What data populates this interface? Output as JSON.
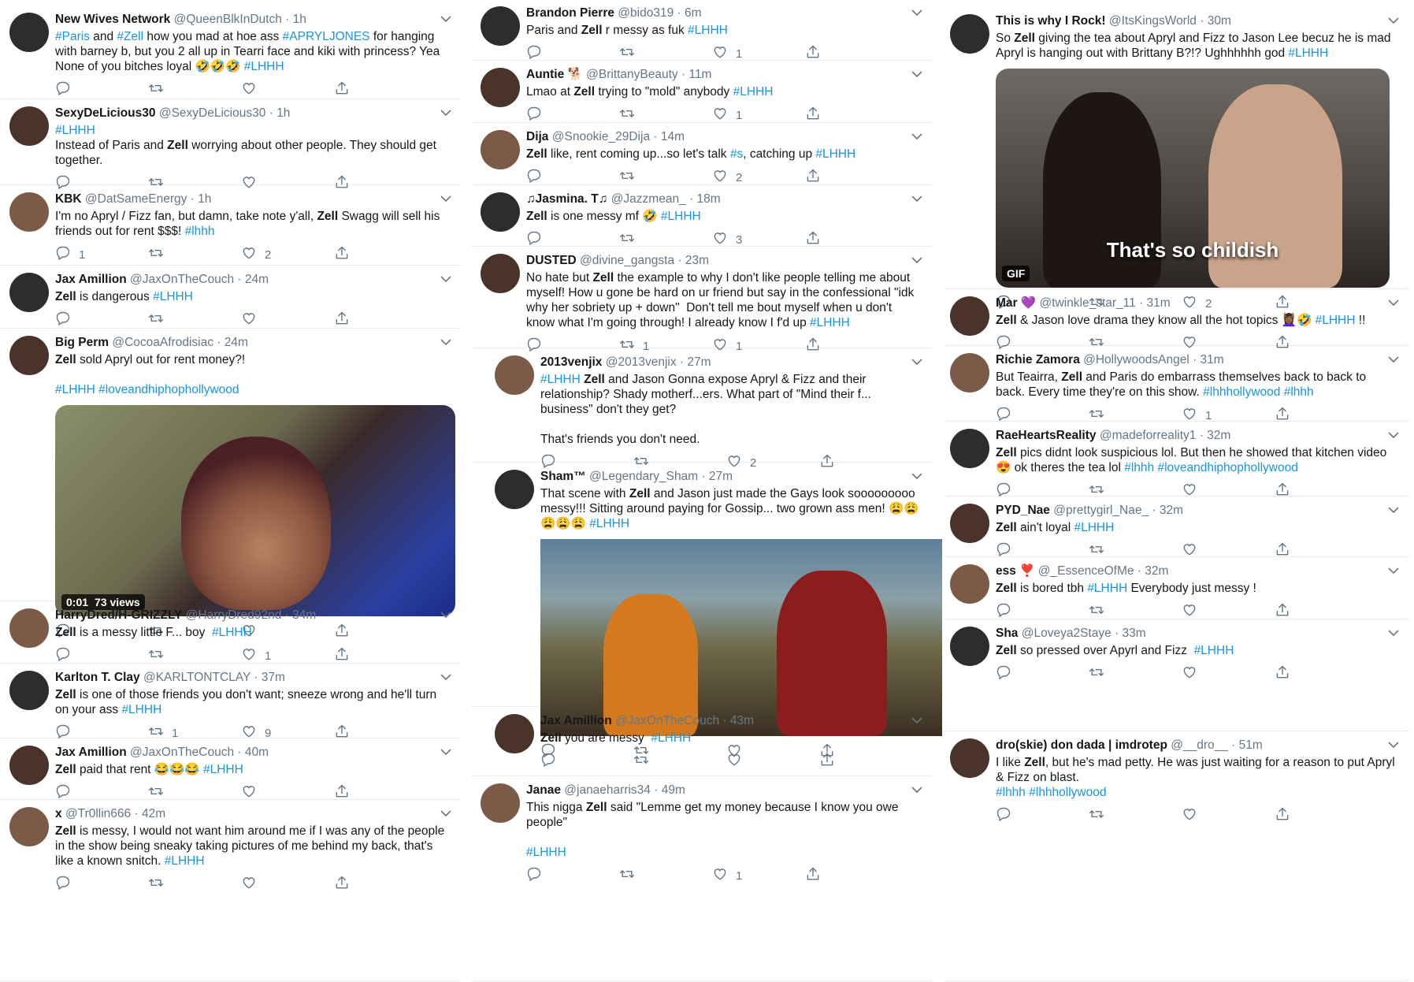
{
  "col1": [
    {
      "name": "New Wives Network",
      "handle": "@QueenBlkInDutch",
      "time": "· 1h",
      "text": [
        {
          "t": "#Paris",
          "k": "tag"
        },
        {
          "t": " and ",
          "k": ""
        },
        {
          "t": "#Zell",
          "k": "tag"
        },
        {
          "t": " how you mad at hoe ass ",
          "k": ""
        },
        {
          "t": "#APRYLJONES",
          "k": "tag"
        },
        {
          "t": " for hanging with barney b, but you 2 all up in Tearri face and kiki with princess? Yea None of you bitches loyal 🤣🤣🤣 ",
          "k": ""
        },
        {
          "t": "#LHHH",
          "k": "tag"
        }
      ],
      "replies": "",
      "retweets": "",
      "likes": ""
    },
    {
      "name": "SexyDeLicious30",
      "handle": "@SexyDeLicious30",
      "time": "· 1h",
      "text": [
        {
          "t": "#LHHH",
          "k": "tag"
        },
        {
          "t": "\nInstead of Paris and ",
          "k": ""
        },
        {
          "t": "Zell",
          "k": "b"
        },
        {
          "t": " worrying about other people. They should get together.",
          "k": ""
        }
      ],
      "replies": "",
      "retweets": "",
      "likes": ""
    },
    {
      "name": "KBK",
      "handle": "@DatSameEnergy",
      "time": "· 1h",
      "text": [
        {
          "t": "I'm no Apryl / Fizz fan, but damn, take note y'all, ",
          "k": ""
        },
        {
          "t": "Zell",
          "k": "b"
        },
        {
          "t": " Swagg will sell his friends out for rent $$$! ",
          "k": ""
        },
        {
          "t": "#lhhh",
          "k": "tag"
        }
      ],
      "replies": "1",
      "retweets": "",
      "likes": "2"
    },
    {
      "name": "Jax Amillion",
      "handle": "@JaxOnTheCouch",
      "time": "· 24m",
      "text": [
        {
          "t": "Zell",
          "k": "b"
        },
        {
          "t": " is dangerous ",
          "k": ""
        },
        {
          "t": "#LHHH",
          "k": "tag"
        }
      ],
      "replies": "",
      "retweets": "",
      "likes": ""
    },
    {
      "name": "Big Perm",
      "handle": "@CocoaAfrodisiac",
      "time": "· 24m",
      "text": [
        {
          "t": "Zell",
          "k": "b"
        },
        {
          "t": " sold Apryl out for rent money?!\n\n",
          "k": ""
        },
        {
          "t": "#LHHH",
          "k": "tag"
        },
        {
          "t": " ",
          "k": ""
        },
        {
          "t": "#loveandhiphophollywood",
          "k": "tag"
        }
      ],
      "video": {
        "duration": "0:01",
        "views": "73 views"
      },
      "replies": "",
      "retweets": "",
      "likes": ""
    },
    {
      "name": "HarryDred/H-GRIZZLY",
      "handle": "@HarryDred92nd",
      "time": "· 34m",
      "text": [
        {
          "t": "Zell",
          "k": "b"
        },
        {
          "t": " is a messy little F... boy  ",
          "k": ""
        },
        {
          "t": "#LHHH",
          "k": "tag"
        }
      ],
      "replies": "",
      "retweets": "",
      "likes": "1"
    },
    {
      "name": "Karlton T. Clay",
      "handle": "@KARLTONTCLAY",
      "time": "· 37m",
      "text": [
        {
          "t": "Zell",
          "k": "b"
        },
        {
          "t": " is one of those friends you don't want; sneeze wrong and he'll turn on your ass ",
          "k": ""
        },
        {
          "t": "#LHHH",
          "k": "tag"
        }
      ],
      "replies": "",
      "retweets": "1",
      "likes": "9"
    },
    {
      "name": "Jax Amillion",
      "handle": "@JaxOnTheCouch",
      "time": "· 40m",
      "text": [
        {
          "t": "Zell",
          "k": "b"
        },
        {
          "t": " paid that rent 😂😂😂 ",
          "k": ""
        },
        {
          "t": "#LHHH",
          "k": "tag"
        }
      ],
      "replies": "",
      "retweets": "",
      "likes": ""
    },
    {
      "name": "x",
      "handle": "@Tr0llin666",
      "time": "· 42m",
      "text": [
        {
          "t": "Zell",
          "k": "b"
        },
        {
          "t": " is messy, I would not want him around me if I was any of the people in the show being sneaky taking pictures of me behind my back, that's like a known snitch. ",
          "k": ""
        },
        {
          "t": "#LHHH",
          "k": "tag"
        }
      ],
      "replies": "",
      "retweets": "",
      "likes": ""
    }
  ],
  "col2": [
    {
      "name": "Brandon Pierre",
      "handle": "@bido319",
      "time": "· 6m",
      "text": [
        {
          "t": "Paris and ",
          "k": ""
        },
        {
          "t": "Zell",
          "k": "b"
        },
        {
          "t": " r messy as fuk ",
          "k": ""
        },
        {
          "t": "#LHHH",
          "k": "tag"
        }
      ],
      "replies": "",
      "retweets": "",
      "likes": "1"
    },
    {
      "name": "Auntie 🐕",
      "handle": "@BrittanyBeauty",
      "time": "· 11m",
      "text": [
        {
          "t": "Lmao at ",
          "k": ""
        },
        {
          "t": "Zell",
          "k": "b"
        },
        {
          "t": " trying to \"mold\" anybody ",
          "k": ""
        },
        {
          "t": "#LHHH",
          "k": "tag"
        }
      ],
      "replies": "",
      "retweets": "",
      "likes": "1"
    },
    {
      "name": "Dija",
      "handle": "@Snookie_29Dija",
      "time": "· 14m",
      "text": [
        {
          "t": "Zell",
          "k": "b"
        },
        {
          "t": " like, rent coming up...so let's talk ",
          "k": ""
        },
        {
          "t": "#s",
          "k": "tag"
        },
        {
          "t": ", catching up ",
          "k": ""
        },
        {
          "t": "#LHHH",
          "k": "tag"
        }
      ],
      "replies": "",
      "retweets": "",
      "likes": "2"
    },
    {
      "name": "♫Jasmina. T♫",
      "handle": "@Jazzmean_",
      "time": "· 18m",
      "text": [
        {
          "t": "Zell",
          "k": "b"
        },
        {
          "t": " is one messy mf 🤣 ",
          "k": ""
        },
        {
          "t": "#LHHH",
          "k": "tag"
        }
      ],
      "replies": "",
      "retweets": "",
      "likes": "3"
    },
    {
      "name": "DUSTED",
      "handle": "@divine_gangsta",
      "time": "· 23m",
      "text": [
        {
          "t": "No hate but ",
          "k": ""
        },
        {
          "t": "Zell",
          "k": "b"
        },
        {
          "t": " the example to why I don't like people telling me about myself! How u gone be hard on ur friend but say in the confessional \"idk why her sobriety up + down\"  Don't tell me bout myself when u don't know what I'm going through! I already know I f'd up ",
          "k": ""
        },
        {
          "t": "#LHHH",
          "k": "tag"
        }
      ],
      "replies": "",
      "retweets": "1",
      "likes": "1"
    },
    {
      "name": "2013venjix",
      "handle": "@2013venjix",
      "time": "· 27m",
      "text": [
        {
          "t": "#LHHH",
          "k": "tag"
        },
        {
          "t": " ",
          "k": ""
        },
        {
          "t": "Zell",
          "k": "b"
        },
        {
          "t": " and Jason Gonna expose Apryl & Fizz and their relationship? Shady motherf...ers. What part of \"Mind their f... business\" don't they get?\n\nThat's friends you don't need.",
          "k": ""
        }
      ],
      "replies": "",
      "retweets": "",
      "likes": "2"
    },
    {
      "name": "Sham™",
      "handle": "@Legendary_Sham",
      "time": "· 27m",
      "text": [
        {
          "t": "That scene with ",
          "k": ""
        },
        {
          "t": "Zell",
          "k": "b"
        },
        {
          "t": " and Jason just made the Gays look sooooooooo messy!!! Sitting around paying for Gossip... two grown ass men! 😩😩😩😩😩 ",
          "k": ""
        },
        {
          "t": "#LHHH",
          "k": "tag"
        }
      ],
      "replies": "",
      "retweets": "",
      "likes": ""
    },
    {
      "name": "Jax Amillion",
      "handle": "@JaxOnTheCouch",
      "time": "· 43m",
      "text": [
        {
          "t": "Zell",
          "k": "b"
        },
        {
          "t": " you are messy  ",
          "k": ""
        },
        {
          "t": "#LHHH",
          "k": "tag"
        }
      ],
      "replies": "",
      "retweets": "",
      "likes": ""
    },
    {
      "name": "Janae",
      "handle": "@janaeharris34",
      "time": "· 49m",
      "text": [
        {
          "t": "This nigga ",
          "k": ""
        },
        {
          "t": "Zell",
          "k": "b"
        },
        {
          "t": " said \"Lemme get my money because I know you owe people\"\n\n",
          "k": ""
        },
        {
          "t": "#LHHH",
          "k": "tag"
        }
      ],
      "replies": "",
      "retweets": "",
      "likes": "1"
    }
  ],
  "col3": [
    {
      "name": "This is why I Rock!",
      "handle": "@ItsKingsWorld",
      "time": "· 30m",
      "text": [
        {
          "t": "So ",
          "k": ""
        },
        {
          "t": "Zell",
          "k": "b"
        },
        {
          "t": " giving the tea about Apryl and Fizz to Jason Lee becuz he is mad Apryl is hanging out with Brittany B?!? Ughhhhhh god ",
          "k": ""
        },
        {
          "t": "#LHHH",
          "k": "tag"
        }
      ],
      "gif": {
        "caption": "That's so childish",
        "label": "GIF"
      },
      "replies": "",
      "retweets": "",
      "likes": "2"
    },
    {
      "name": "Mar 💜",
      "handle": "@twinkle_star_11",
      "time": "· 31m",
      "text": [
        {
          "t": "Zell",
          "k": "b"
        },
        {
          "t": " & Jason love drama they know all the hot topics 💆🏾‍♀️🤣 ",
          "k": ""
        },
        {
          "t": "#LHHH",
          "k": "tag"
        },
        {
          "t": " !!",
          "k": ""
        }
      ],
      "replies": "",
      "retweets": "",
      "likes": ""
    },
    {
      "name": "Richie Zamora",
      "handle": "@HollywoodsAngel",
      "time": "· 31m",
      "text": [
        {
          "t": "But Teairra, ",
          "k": ""
        },
        {
          "t": "Zell",
          "k": "b"
        },
        {
          "t": " and Paris do embarrass themselves back to back to back. Every time they're on this show. ",
          "k": ""
        },
        {
          "t": "#lhhhollywood",
          "k": "tag"
        },
        {
          "t": " ",
          "k": ""
        },
        {
          "t": "#lhhh",
          "k": "tag"
        }
      ],
      "replies": "",
      "retweets": "",
      "likes": "1"
    },
    {
      "name": "RaeHeartsReality",
      "handle": "@madeforreality1",
      "time": "· 32m",
      "text": [
        {
          "t": "Zell",
          "k": "b"
        },
        {
          "t": " pics didnt look suspicious lol. But then he showed that kitchen video 😍 ok theres the tea lol ",
          "k": ""
        },
        {
          "t": "#lhhh",
          "k": "tag"
        },
        {
          "t": " ",
          "k": ""
        },
        {
          "t": "#loveandhiphophollywood",
          "k": "tag"
        }
      ],
      "replies": "",
      "retweets": "",
      "likes": ""
    },
    {
      "name": "PYD_Nae",
      "handle": "@prettygirl_Nae_",
      "time": "· 32m",
      "text": [
        {
          "t": "Zell",
          "k": "b"
        },
        {
          "t": " ain't loyal ",
          "k": ""
        },
        {
          "t": "#LHHH",
          "k": "tag"
        }
      ],
      "replies": "",
      "retweets": "",
      "likes": ""
    },
    {
      "name": "ess ❣️",
      "handle": "@_EssenceOfMe",
      "time": "· 32m",
      "text": [
        {
          "t": "Zell",
          "k": "b"
        },
        {
          "t": " is bored tbh ",
          "k": ""
        },
        {
          "t": "#LHHH",
          "k": "tag"
        },
        {
          "t": " Everybody just messy !",
          "k": ""
        }
      ],
      "replies": "",
      "retweets": "",
      "likes": ""
    },
    {
      "name": "Sha",
      "handle": "@Loveya2Staye",
      "time": "· 33m",
      "text": [
        {
          "t": "Zell",
          "k": "b"
        },
        {
          "t": " so pressed over Apyrl and Fizz  ",
          "k": ""
        },
        {
          "t": "#LHHH",
          "k": "tag"
        }
      ],
      "replies": "",
      "retweets": "",
      "likes": ""
    },
    {
      "name": "dro(skie) don dada | imdrotep",
      "handle": "@__dro__",
      "time": "· 51m",
      "text": [
        {
          "t": "I like ",
          "k": ""
        },
        {
          "t": "Zell",
          "k": "b"
        },
        {
          "t": ", but he's mad petty. He was just waiting for a reason to put Apryl & Fizz on blast.\n",
          "k": ""
        },
        {
          "t": "#lhhh",
          "k": "tag"
        },
        {
          "t": " ",
          "k": ""
        },
        {
          "t": "#lhhhollywood",
          "k": "tag"
        }
      ],
      "replies": "",
      "retweets": "",
      "likes": ""
    }
  ]
}
